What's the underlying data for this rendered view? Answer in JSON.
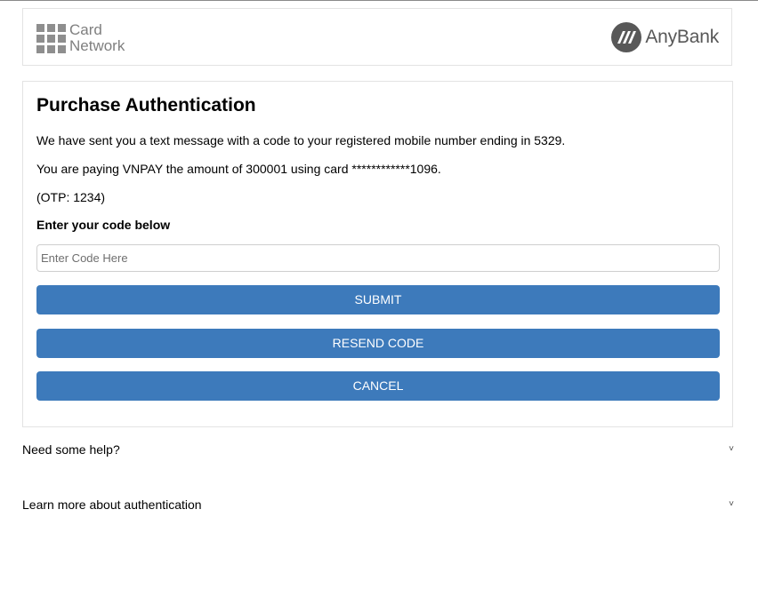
{
  "header": {
    "card_network_line1": "Card",
    "card_network_line2": "Network",
    "bank_name": "AnyBank"
  },
  "main": {
    "title": "Purchase Authentication",
    "message_sent": "We have sent you a text message with a code to your registered mobile number ending in 5329.",
    "message_paying": "You are paying VNPAY the amount of 300001 using card ************1096.",
    "message_otp": "(OTP: 1234)",
    "code_label": "Enter your code below",
    "code_placeholder": "Enter Code Here",
    "code_value": "",
    "submit_label": "SUBMIT",
    "resend_label": "RESEND CODE",
    "cancel_label": "CANCEL"
  },
  "help": {
    "need_help_label": "Need some help?",
    "learn_more_label": "Learn more about authentication",
    "chevron_glyph": "˅"
  },
  "colors": {
    "button_bg": "#3d7abb",
    "button_text": "#ffffff",
    "logo_gray": "#585858"
  },
  "icons": [
    "card-network-grid-icon",
    "anybank-logo-icon",
    "chevron-down-icon"
  ]
}
